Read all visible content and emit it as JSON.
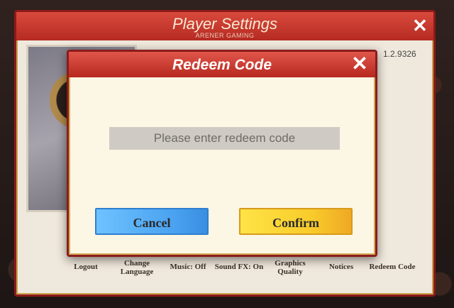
{
  "settings": {
    "title": "Player Settings",
    "watermark": "ARENER GAMING",
    "version": "1.2.9326",
    "close_icon": "close-icon",
    "buttons": [
      {
        "label": "Logout"
      },
      {
        "label": "Change Language"
      },
      {
        "label": "Music: Off"
      },
      {
        "label": "Sound FX: On"
      },
      {
        "label": "Graphics Quality"
      },
      {
        "label": "Notices"
      },
      {
        "label": "Redeem Code"
      }
    ]
  },
  "dialog": {
    "title": "Redeem Code",
    "input_placeholder": "Please enter redeem code",
    "input_value": "",
    "cancel_label": "Cancel",
    "confirm_label": "Confirm",
    "close_icon": "close-icon"
  },
  "colors": {
    "header_red": "#b7281f",
    "cancel_blue": "#4aa2f0",
    "confirm_yellow": "#f8cb2a"
  }
}
